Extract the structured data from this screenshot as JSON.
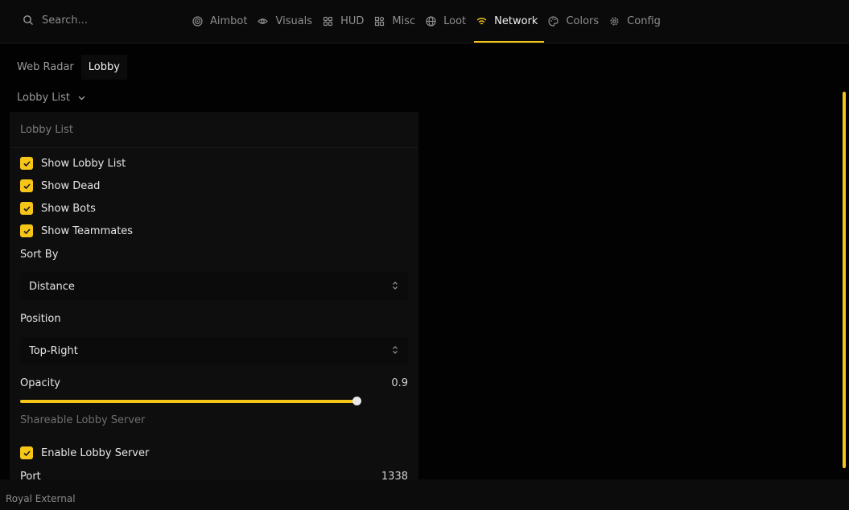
{
  "search": {
    "placeholder": "Search...",
    "icon": "search-icon"
  },
  "nav": {
    "items": [
      {
        "label": "Aimbot",
        "icon": "target-icon"
      },
      {
        "label": "Visuals",
        "icon": "eye-icon"
      },
      {
        "label": "HUD",
        "icon": "hud-icon"
      },
      {
        "label": "Misc",
        "icon": "apps-icon"
      },
      {
        "label": "Loot",
        "icon": "globe-icon"
      },
      {
        "label": "Network",
        "icon": "wifi-icon"
      },
      {
        "label": "Colors",
        "icon": "palette-icon"
      },
      {
        "label": "Config",
        "icon": "gear-icon"
      }
    ],
    "active": "Network"
  },
  "subtabs": {
    "items": [
      "Web Radar",
      "Lobby"
    ],
    "active": "Lobby"
  },
  "dropdown": {
    "label": "Lobby List"
  },
  "panel": {
    "title": "Lobby List",
    "checks": [
      {
        "label": "Show Lobby List",
        "checked": true
      },
      {
        "label": "Show Dead",
        "checked": true
      },
      {
        "label": "Show Bots",
        "checked": true
      },
      {
        "label": "Show Teammates",
        "checked": true
      }
    ],
    "sort_by": {
      "label": "Sort By",
      "value": "Distance"
    },
    "position": {
      "label": "Position",
      "value": "Top-Right"
    },
    "opacity": {
      "label": "Opacity",
      "value": "0.9",
      "fraction": 0.9
    },
    "server_section": "Shareable Lobby Server",
    "server_check": {
      "label": "Enable Lobby Server",
      "checked": true
    },
    "port": {
      "label": "Port",
      "value": "1338"
    }
  },
  "footer": {
    "brand": "Royal External"
  },
  "colors": {
    "accent": "#f5c518",
    "background": "#020202",
    "panel": "#0e0e0e"
  }
}
